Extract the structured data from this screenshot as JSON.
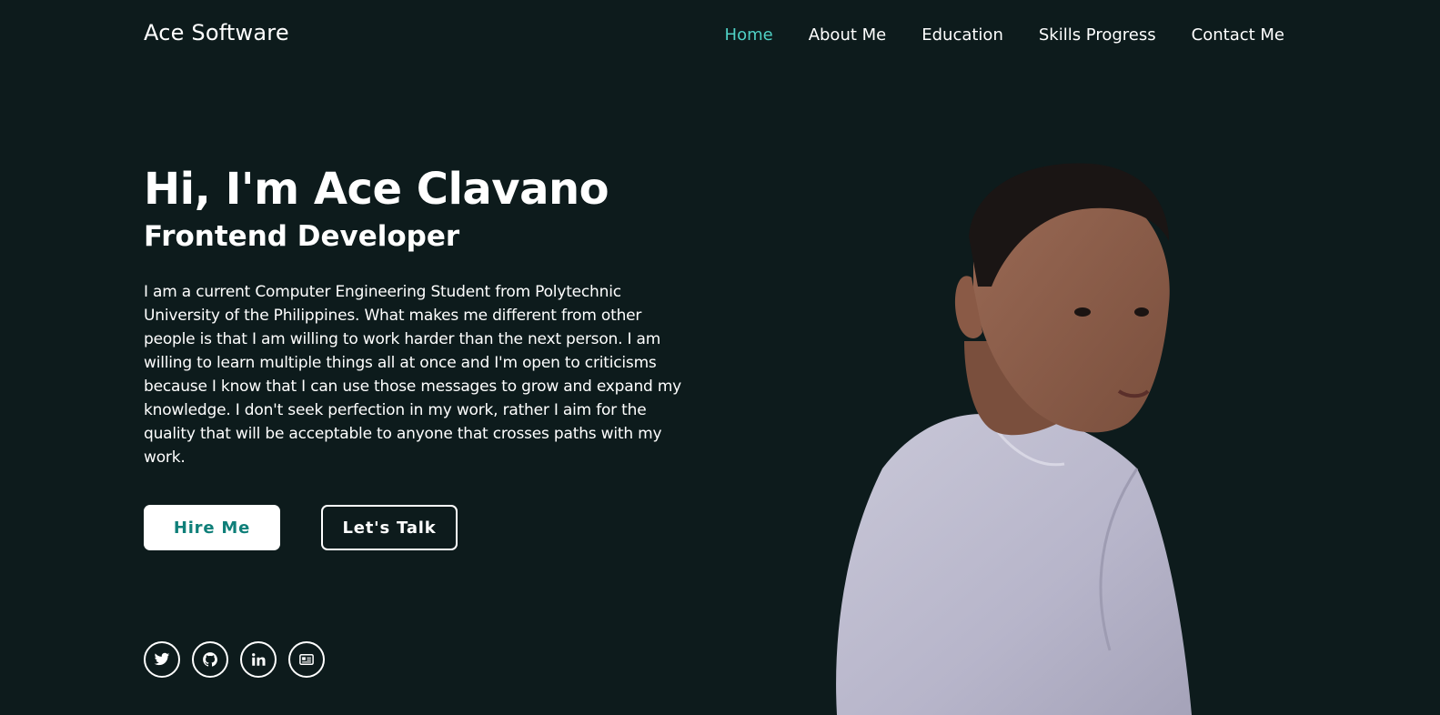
{
  "nav": {
    "brand": "Ace Software",
    "links": [
      "Home",
      "About Me",
      "Education",
      "Skills Progress",
      "Contact Me"
    ],
    "active": "Home"
  },
  "hero": {
    "title": "Hi, I'm Ace Clavano",
    "subtitle": "Frontend Developer",
    "bio": "I am a current Computer Engineering Student from Polytechnic University of the Philippines. What makes me different from other people is that I am willing to work harder than the next person. I am willing to learn multiple things all at once and I'm open to criticisms because I know that I can use those messages to grow and expand my knowledge. I don't seek perfection in my work, rather I aim for the quality that will be acceptable to anyone that crosses paths with my work.",
    "primary_button": "Hire Me",
    "secondary_button": "Let's Talk"
  },
  "socials": [
    "twitter-icon",
    "github-icon",
    "linkedin-icon",
    "id-card-icon"
  ],
  "colors": {
    "background": "#0d1b1c",
    "accent": "#4fd1c5",
    "button_text": "#0f7f79",
    "text": "#ffffff"
  }
}
